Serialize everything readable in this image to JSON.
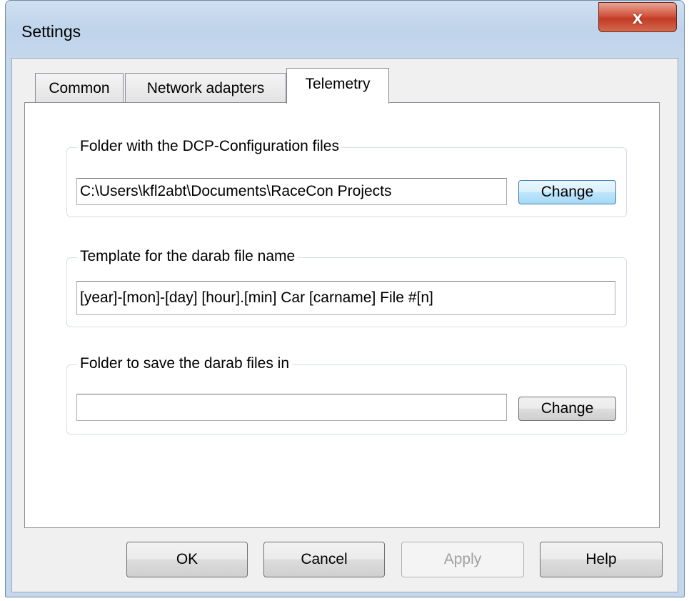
{
  "window": {
    "title": "Settings",
    "close_symbol": "x"
  },
  "tabs": [
    {
      "label": "Common",
      "active": false
    },
    {
      "label": "Network adapters",
      "active": false
    },
    {
      "label": "Telemetry",
      "active": true
    }
  ],
  "groups": {
    "dcp_folder": {
      "label": "Folder with the DCP-Configuration files",
      "value": "C:\\Users\\kfl2abt\\Documents\\RaceCon Projects",
      "button": "Change"
    },
    "template": {
      "label": "Template for the darab file name",
      "value": "[year]-[mon]-[day] [hour].[min] Car [carname] File #[n]"
    },
    "save_folder": {
      "label": "Folder to save the darab files in",
      "value": "",
      "button": "Change"
    }
  },
  "footer": {
    "ok": "OK",
    "cancel": "Cancel",
    "apply": "Apply",
    "help": "Help"
  },
  "colors": {
    "close_button": "#c74a34",
    "focus_button_border": "#3c7fb1"
  }
}
